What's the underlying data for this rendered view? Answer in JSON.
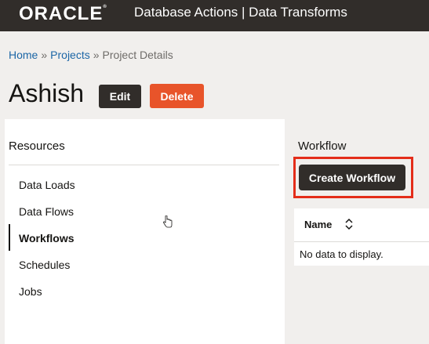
{
  "header": {
    "logo": "ORACLE",
    "app_title": "Database Actions | Data Transforms"
  },
  "breadcrumb": {
    "home": "Home",
    "separator1": "»",
    "projects": "Projects",
    "separator2": "»",
    "current": "Project Details"
  },
  "project": {
    "name": "Ashish",
    "edit_label": "Edit",
    "delete_label": "Delete"
  },
  "resources": {
    "title": "Resources",
    "items": [
      {
        "label": "Data Loads",
        "active": false
      },
      {
        "label": "Data Flows",
        "active": false
      },
      {
        "label": "Workflows",
        "active": true
      },
      {
        "label": "Schedules",
        "active": false
      },
      {
        "label": "Jobs",
        "active": false
      }
    ]
  },
  "workflow": {
    "title": "Workflow",
    "create_label": "Create Workflow",
    "table": {
      "columns": [
        "Name"
      ],
      "empty_message": "No data to display."
    }
  },
  "colors": {
    "header_bg": "#312d2a",
    "delete_button": "#e8542a",
    "highlight_border": "#e42d1a",
    "link": "#1c66a6"
  }
}
